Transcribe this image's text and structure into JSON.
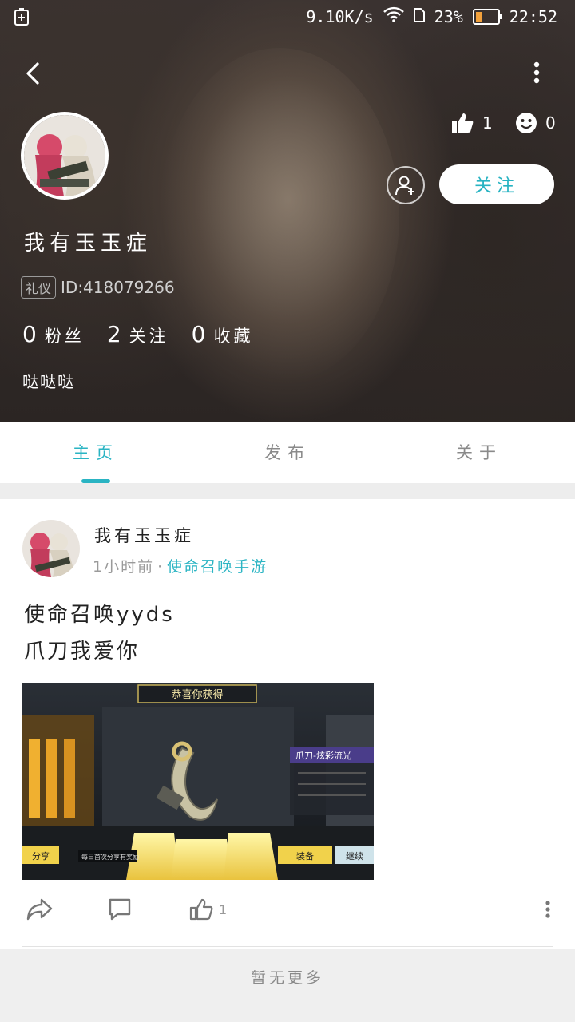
{
  "status_bar": {
    "net_speed": "9.10K/s",
    "battery_percent": "23%",
    "time": "22:52"
  },
  "profile": {
    "username": "我有玉玉症",
    "id_tag": "礼仪",
    "id_text": "ID:418079266",
    "likes": "1",
    "moods": "0",
    "follow_label": "关注",
    "stats": [
      {
        "num": "0",
        "label": "粉丝"
      },
      {
        "num": "2",
        "label": "关注"
      },
      {
        "num": "0",
        "label": "收藏"
      }
    ],
    "bio": "哒哒哒"
  },
  "tabs": [
    {
      "label": "主页",
      "active": true
    },
    {
      "label": "发布",
      "active": false
    },
    {
      "label": "关于",
      "active": false
    }
  ],
  "post": {
    "author": "我有玉玉症",
    "time": "1小时前",
    "separator": "·",
    "game": "使命召唤手游",
    "lines": [
      "使命召唤yyds",
      "爪刀我爱你"
    ],
    "like_count": "1",
    "image": {
      "banner": "恭喜你获得",
      "item_name": "爪刀-炫彩流光",
      "share": "分享",
      "share_hint": "每日首次分享有奖励",
      "equip": "装备",
      "continue": "继续"
    }
  },
  "footer": {
    "no_more": "暂无更多"
  },
  "colors": {
    "accent": "#2ab4c3"
  }
}
